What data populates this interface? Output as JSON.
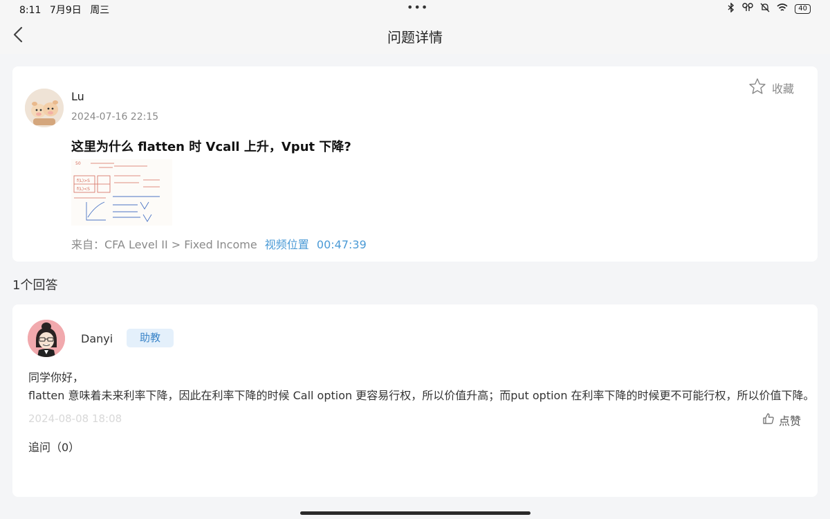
{
  "status": {
    "time": "8:11",
    "date": "7月9日",
    "weekday": "周三",
    "battery": "40",
    "icons": [
      "bluetooth-icon",
      "earbuds-icon",
      "mute-bell-icon",
      "wifi-icon",
      "battery-icon"
    ]
  },
  "nav": {
    "title": "问题详情",
    "back_icon": "back-chevron-icon"
  },
  "question": {
    "user": "Lu",
    "time": "2024-07-16 22:15",
    "favorite_label": "收藏",
    "text": "这里为什么 flatten 时 Vcall 上升，Vput 下降?",
    "source_label": "来自：CFA Level II > Fixed Income",
    "video_label": "视频位置",
    "video_time": "00:47:39"
  },
  "answers_count": "1个回答",
  "answer": {
    "user": "Danyi",
    "badge": "助教",
    "text_line1": "同学你好，",
    "text_line2": "flatten 意味着未来利率下降，因此在利率下降的时候 Call option 更容易行权，所以价值升高；而put option 在利率下降的时候更不可能行权，所以价值下降。",
    "time": "2024-08-08 18:08",
    "like_label": "点赞",
    "follow_up": "追问（0）"
  },
  "colors": {
    "background": "#f4f5f7",
    "card": "#ffffff",
    "link": "#4a9ad6",
    "badge_bg": "#e4f0fb",
    "badge_text": "#3a84c8"
  }
}
